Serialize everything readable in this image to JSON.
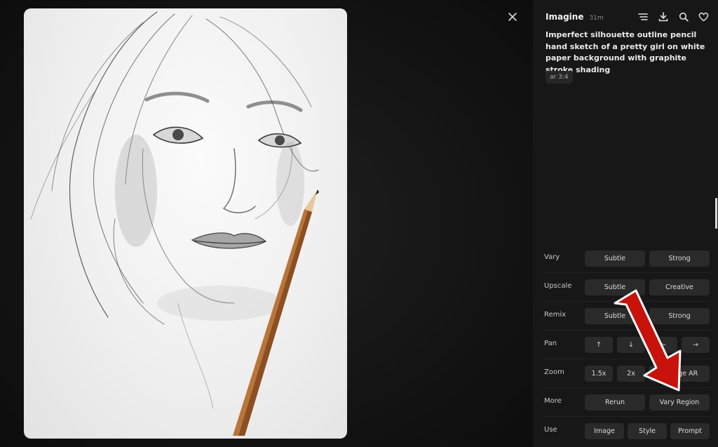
{
  "header": {
    "title": "Imagine",
    "time": "31m"
  },
  "icons": {
    "close": "close-icon",
    "filter": "filter-lines-icon",
    "download": "download-icon",
    "search": "search-icon",
    "like": "heart-icon"
  },
  "prompt": {
    "text": "Imperfect silhouette outline pencil hand sketch of a pretty girl on white paper background with graphite stroke shading",
    "aspect_ratio": "ar 3:4"
  },
  "actions": {
    "vary": {
      "label": "Vary",
      "subtle": "Subtle",
      "strong": "Strong"
    },
    "upscale": {
      "label": "Upscale",
      "subtle": "Subtle",
      "creative": "Creative"
    },
    "remix": {
      "label": "Remix",
      "subtle": "Subtle",
      "strong": "Strong"
    },
    "pan": {
      "label": "Pan",
      "up": "↑",
      "down": "↓",
      "left": "←",
      "right": "→"
    },
    "zoom": {
      "label": "Zoom",
      "z15": "1.5x",
      "z2": "2x",
      "change_ar": "Change AR"
    },
    "more": {
      "label": "More",
      "rerun": "Rerun",
      "vary_region": "Vary Region"
    },
    "use": {
      "label": "Use",
      "image": "Image",
      "style": "Style",
      "prompt": "Prompt"
    }
  },
  "colors": {
    "accent_arrow": "#c8120c",
    "panel_bg": "#171717",
    "button_bg": "#2a2a2a"
  }
}
